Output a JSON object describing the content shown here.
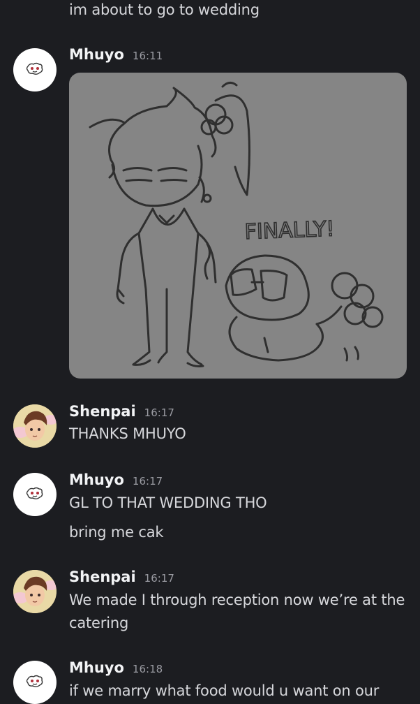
{
  "messages": [
    {
      "kind": "continuation",
      "text": "im about to go to wedding"
    },
    {
      "kind": "image",
      "author": "Mhuyo",
      "time": "16:11",
      "image_text": "FINALLY!"
    },
    {
      "kind": "text",
      "author": "Shenpai",
      "time": "16:17",
      "lines": [
        "THANKS MHUYO"
      ]
    },
    {
      "kind": "text",
      "author": "Mhuyo",
      "time": "16:17",
      "lines": [
        "GL TO THAT WEDDING THO",
        "bring me cak"
      ]
    },
    {
      "kind": "text",
      "author": "Shenpai",
      "time": "16:17",
      "lines": [
        "We made I through reception now we’re at the catering"
      ]
    },
    {
      "kind": "text",
      "author": "Mhuyo",
      "time": "16:18",
      "lines": [
        "if we marry what food would u want on our"
      ]
    }
  ],
  "icons": {
    "mhuyo_avatar": "doodle-avatar-icon",
    "shenpai_avatar": "anime-avatar-icon"
  },
  "colors": {
    "background": "#1c1d21",
    "text": "#d6d7db",
    "username": "#f2f3f5",
    "timestamp": "#9a9ba2",
    "image_bg": "#858585"
  }
}
